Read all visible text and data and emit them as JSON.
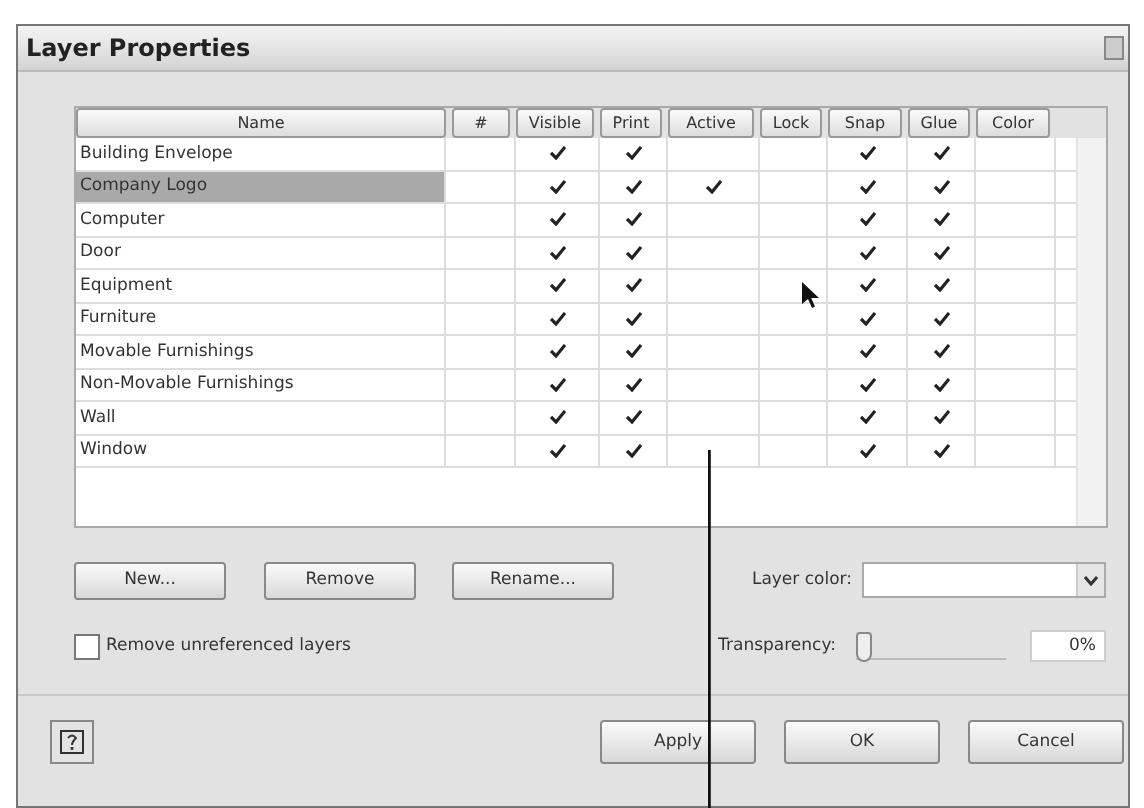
{
  "window": {
    "title": "Layer Properties"
  },
  "table": {
    "columns": [
      "Name",
      "#",
      "Visible",
      "Print",
      "Active",
      "Lock",
      "Snap",
      "Glue",
      "Color"
    ],
    "rows": [
      {
        "name": "Building Envelope",
        "selected": false,
        "visible": true,
        "print": true,
        "active": false,
        "lock": false,
        "snap": true,
        "glue": true
      },
      {
        "name": "Company Logo",
        "selected": true,
        "visible": true,
        "print": true,
        "active": true,
        "lock": false,
        "snap": true,
        "glue": true
      },
      {
        "name": "Computer",
        "selected": false,
        "visible": true,
        "print": true,
        "active": false,
        "lock": false,
        "snap": true,
        "glue": true
      },
      {
        "name": "Door",
        "selected": false,
        "visible": true,
        "print": true,
        "active": false,
        "lock": false,
        "snap": true,
        "glue": true
      },
      {
        "name": "Equipment",
        "selected": false,
        "visible": true,
        "print": true,
        "active": false,
        "lock": false,
        "snap": true,
        "glue": true
      },
      {
        "name": "Furniture",
        "selected": false,
        "visible": true,
        "print": true,
        "active": false,
        "lock": false,
        "snap": true,
        "glue": true
      },
      {
        "name": "Movable Furnishings",
        "selected": false,
        "visible": true,
        "print": true,
        "active": false,
        "lock": false,
        "snap": true,
        "glue": true
      },
      {
        "name": "Non-Movable Furnishings",
        "selected": false,
        "visible": true,
        "print": true,
        "active": false,
        "lock": false,
        "snap": true,
        "glue": true
      },
      {
        "name": "Wall",
        "selected": false,
        "visible": true,
        "print": true,
        "active": false,
        "lock": false,
        "snap": true,
        "glue": true
      },
      {
        "name": "Window",
        "selected": false,
        "visible": true,
        "print": true,
        "active": false,
        "lock": false,
        "snap": true,
        "glue": true
      }
    ]
  },
  "layer_buttons": [
    "New...",
    "Remove",
    "Rename..."
  ],
  "layer_color": {
    "label": "Layer color:"
  },
  "remove_unreferenced": {
    "label": "Remove unreferenced layers",
    "checked": false
  },
  "transparency": {
    "label": "Transparency:",
    "level": 0,
    "value": "0%"
  },
  "footer_buttons": [
    "Apply",
    "OK",
    "Cancel"
  ]
}
